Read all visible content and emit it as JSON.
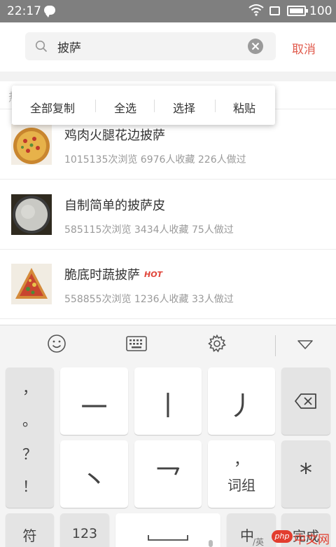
{
  "status_bar": {
    "time": "22:17",
    "battery_level": "100",
    "icons": [
      "chat-icon",
      "wifi-icon",
      "screen-icon",
      "battery-icon"
    ]
  },
  "search": {
    "value": "披萨",
    "cancel_label": "取消",
    "accent_color": "#e05a4c"
  },
  "ghost_text": "热",
  "context_menu": {
    "items": [
      "全部复制",
      "全选",
      "选择",
      "粘贴"
    ]
  },
  "results": [
    {
      "title": "鸡肉火腿花边披萨",
      "meta": "1015135次浏览 6976人收藏 226人做过",
      "hot": ""
    },
    {
      "title": "自制简单的披萨皮",
      "meta": "585115次浏览 3434人收藏 75人做过",
      "hot": ""
    },
    {
      "title": "脆底时蔬披萨",
      "meta": "558855次浏览 1236人收藏 33人做过",
      "hot": "HOT"
    }
  ],
  "keyboard": {
    "toolbar": [
      "emoji-icon",
      "keyboard-icon",
      "settings-icon",
      "collapse-icon"
    ],
    "punctuation": [
      "，",
      "。",
      "？",
      "！"
    ],
    "strokes": [
      "一",
      "丨",
      "丿",
      "丶",
      "乛"
    ],
    "group_key": {
      "top": "，",
      "label": "词组"
    },
    "star": "*",
    "symbol_label": "符",
    "number_label": "123",
    "lang_main": "中",
    "lang_sub": "/英",
    "done_label": "完成"
  },
  "watermark": {
    "prefix": "php",
    "text": "中文网"
  }
}
